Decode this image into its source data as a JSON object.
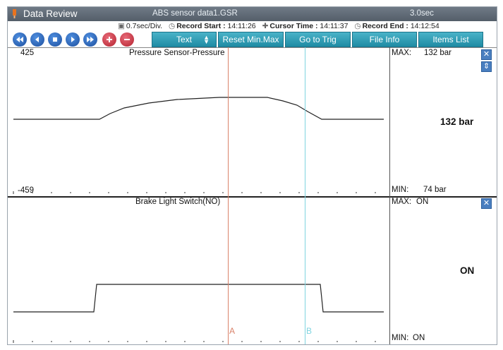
{
  "window": {
    "title": "Data Review",
    "file": "ABS sensor data1.GSR",
    "window_duration": "3.0sec"
  },
  "info": {
    "division": "0.7sec/Div.",
    "record_start_label": "Record Start :",
    "record_start": "14:11:26",
    "cursor_time_label": "Cursor Time :",
    "cursor_time": "14:11:37",
    "record_end_label": "Record End :",
    "record_end": "14:12:54"
  },
  "toolbar": {
    "nav_buttons": [
      "rewind",
      "step-back",
      "stop",
      "play",
      "fast-forward"
    ],
    "zoom_buttons": [
      "zoom-in",
      "zoom-out"
    ],
    "text_label": "Text",
    "reset_label": "Reset Min.Max",
    "trig_label": "Go to Trig",
    "fileinfo_label": "File Info",
    "items_label": "Items List"
  },
  "channels": [
    {
      "name": "Pressure Sensor-Pressure",
      "axis_top": "425",
      "axis_bottom": "-459",
      "max_label": "MAX:",
      "max_value": "132 bar",
      "min_label": "MIN:",
      "min_value": "74 bar",
      "current": "132 bar"
    },
    {
      "name": "Brake Light Switch(NO)",
      "max_label": "MAX:",
      "max_value": "ON",
      "min_label": "MIN:",
      "min_value": "ON",
      "current": "ON"
    }
  ],
  "cursors": {
    "a_label": "A",
    "b_label": "B",
    "a_color": "#d9826a",
    "b_color": "#7fd4e0"
  },
  "colors": {
    "titlebar": "#5f6a75",
    "button": "#2a9bb5",
    "nav_button": "#1d5fb8",
    "zoom_button": "#c9303e"
  }
}
